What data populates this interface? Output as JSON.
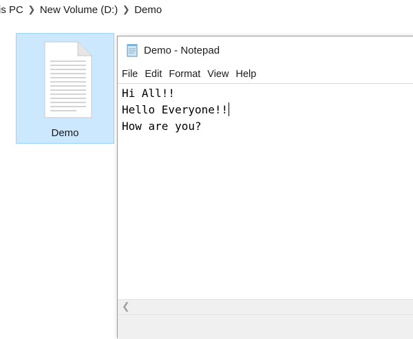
{
  "explorer": {
    "breadcrumb": [
      "is PC",
      "New Volume (D:)",
      "Demo"
    ],
    "file": {
      "name": "Demo",
      "icon": "text-document-icon"
    },
    "colors": {
      "selection_bg": "#cce8ff",
      "selection_border": "#99d1ff"
    }
  },
  "notepad": {
    "title": "Demo - Notepad",
    "icon": "notepad-icon",
    "menu": [
      "File",
      "Edit",
      "Format",
      "View",
      "Help"
    ],
    "lines": [
      "Hi All!!",
      "Hello Everyone!!",
      "How are you?"
    ],
    "scroll_left_icon": "chevron-left-icon"
  }
}
